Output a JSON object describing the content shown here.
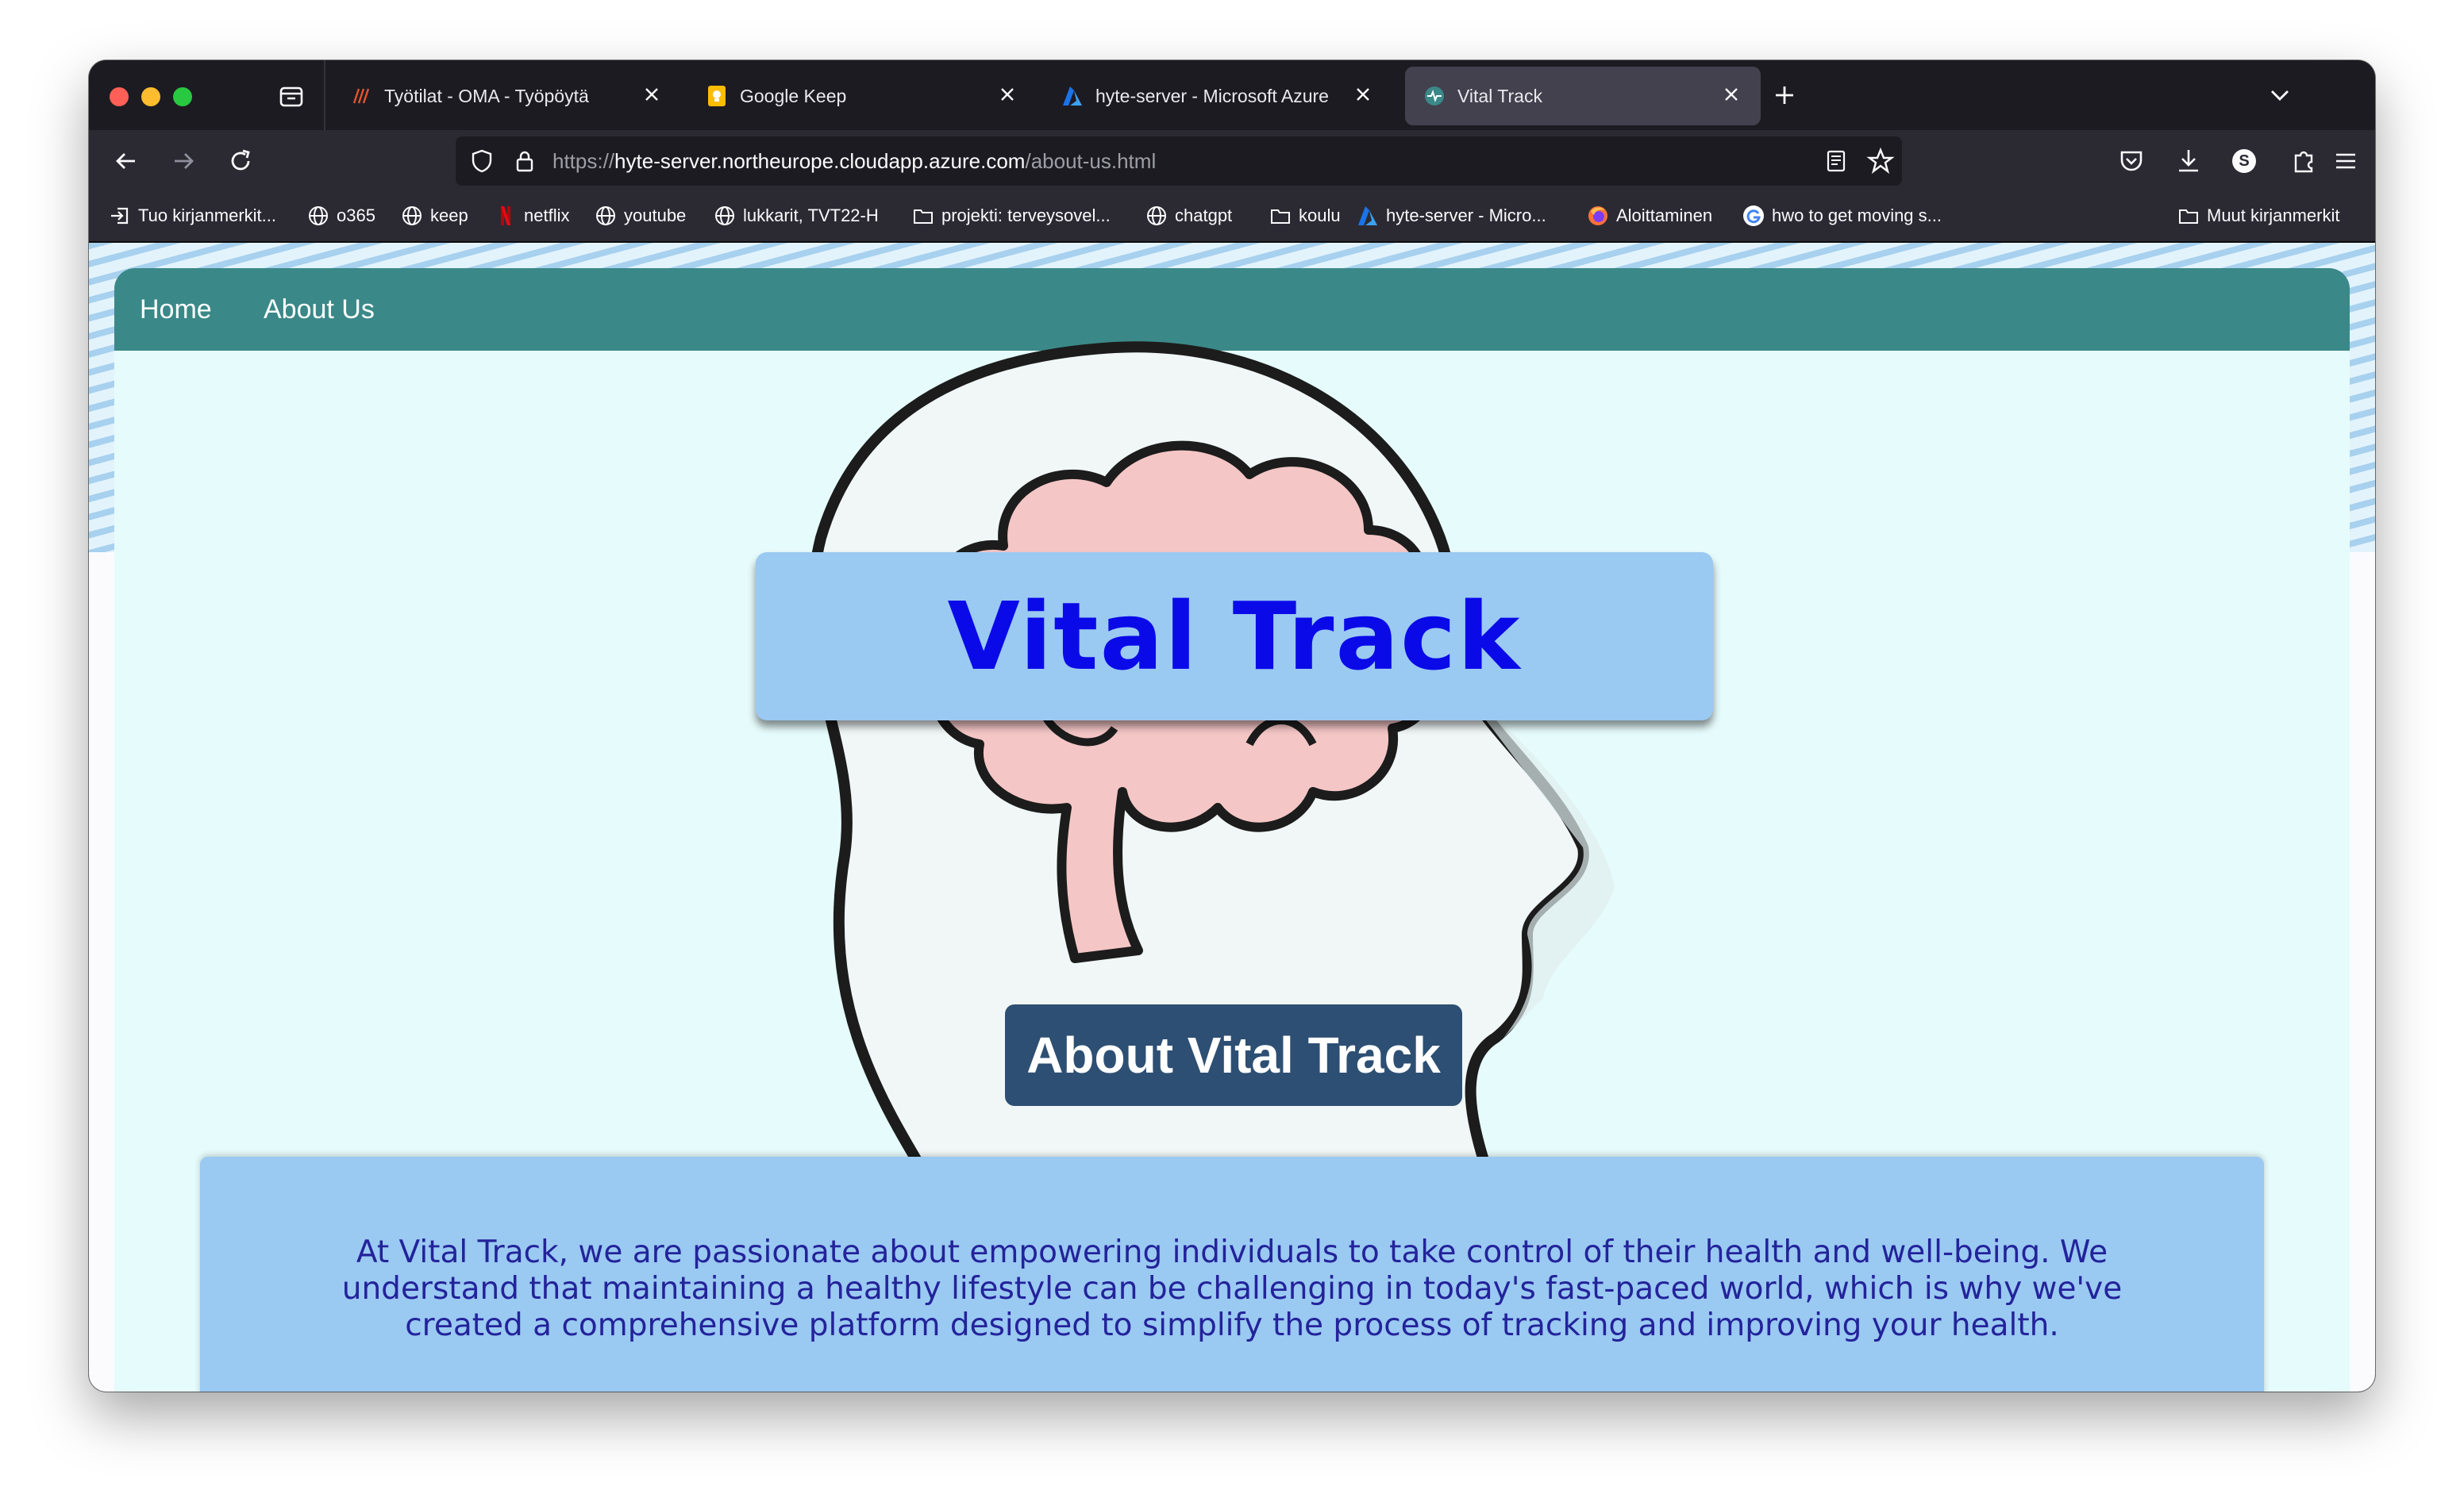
{
  "browser": {
    "tabs": [
      {
        "title": "Työtilat - OMA - Työpöytä",
        "favicon": "oma-icon",
        "active": false
      },
      {
        "title": "Google Keep",
        "favicon": "keep-icon",
        "active": false
      },
      {
        "title": "hyte-server - Microsoft Azure",
        "favicon": "azure-icon",
        "active": false
      },
      {
        "title": "Vital Track",
        "favicon": "vitaltrack-icon",
        "active": true
      }
    ],
    "url": {
      "scheme": "https://",
      "host": "hyte-server.northeurope.cloudapp.azure.com",
      "path": "/about-us.html"
    },
    "bookmarks": [
      {
        "label": "Tuo kirjanmerkit...",
        "icon": "import-icon"
      },
      {
        "label": "o365",
        "icon": "globe-icon"
      },
      {
        "label": "keep",
        "icon": "globe-icon"
      },
      {
        "label": "netflix",
        "icon": "netflix-icon"
      },
      {
        "label": "youtube",
        "icon": "globe-icon"
      },
      {
        "label": "lukkarit, TVT22-H",
        "icon": "globe-icon"
      },
      {
        "label": "projekti: terveysovel...",
        "icon": "folder-icon"
      },
      {
        "label": "chatgpt",
        "icon": "globe-icon"
      },
      {
        "label": "koulu",
        "icon": "folder-icon"
      },
      {
        "label": "hyte-server - Micro...",
        "icon": "azure-icon"
      },
      {
        "label": "Aloittaminen",
        "icon": "firefox-icon"
      },
      {
        "label": "hwo to get moving s...",
        "icon": "google-icon"
      }
    ],
    "other_bookmarks": "Muut kirjanmerkit",
    "profile_initial": "S"
  },
  "site": {
    "nav": {
      "home": "Home",
      "about": "About Us"
    },
    "title": "Vital Track",
    "about_heading": "About Vital Track",
    "about_text": "At Vital Track, we are passionate about empowering individuals to take control of their health and well-being. We understand that maintaining a healthy lifestyle can be challenging in today's fast-paced world, which is why we've created a comprehensive platform designed to simplify the process of tracking and improving your health."
  },
  "colors": {
    "site_nav": "#3b8888",
    "card_bg": "#e6fbfb",
    "title_box": "#9ac9f2",
    "title_text": "#0a0ae8",
    "about_button": "#2d4f73",
    "about_text": "#23239a"
  }
}
